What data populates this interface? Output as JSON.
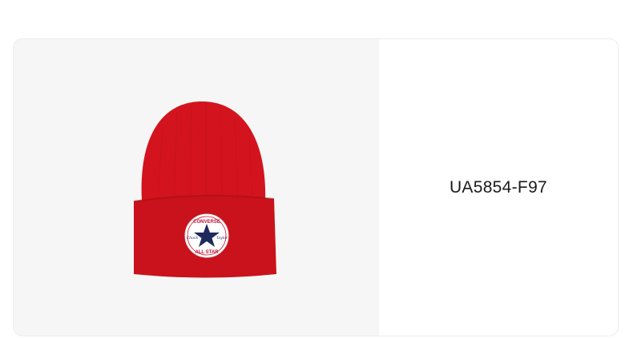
{
  "product": {
    "image_alt": "Red knit beanie with Converse Chuck Taylor All Star patch",
    "sku": "UA5854-F97",
    "patch": {
      "top_text": "CONVERSE",
      "bottom_text": "ALL STAR",
      "left_script": "Chuck",
      "right_script": "Taylor"
    }
  },
  "colors": {
    "card_background": "#ffffff",
    "image_background": "#f6f6f6",
    "beanie_red": "#d3141e",
    "patch_navy": "#1f2a5c",
    "patch_red": "#c8102e"
  }
}
